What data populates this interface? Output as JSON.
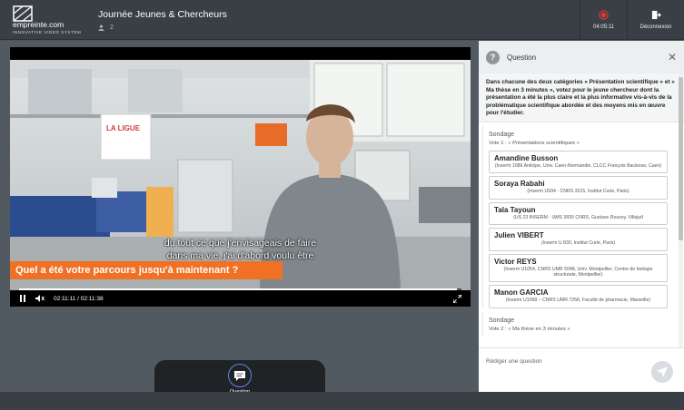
{
  "header": {
    "brand_name": "empreinte.com",
    "brand_tagline": "INNOVATIVE VIDEO SYSTEM",
    "event_title": "Journée Jeunes & Chercheurs",
    "viewer_count": "2",
    "record_time": "04:05:11",
    "logout_label": "Déconnexion"
  },
  "video": {
    "subtitle_line1": "du tout ce que j'envisageais de faire",
    "subtitle_line2": "dans ma vie, j'ai d'abord voulu être",
    "banner_text": "Quel a été votre parcours jusqu'à maintenant ?",
    "time_display": "02:11:11 / 02:11:38",
    "progress": 0.99
  },
  "tray": {
    "question_label": "Question"
  },
  "panel": {
    "title": "Question",
    "intro": "Dans chacune des deux catégories « Présentation scientifique » et « Ma thèse en 3 minutes », votez pour le jeune chercheur dont la présentation a été la plus claire et la plus informative vis-à-vis de la problématique scientifique abordée et des moyens mis en œuvre pour l'étudier.",
    "poll1": {
      "title": "Sondage",
      "vote": "Vote 1 : « Présentations scientifiques »",
      "candidates": [
        {
          "name": "Amandine Busson",
          "aff": "(Inserm 1086 Anticipe, Univ. Caen-Normandie, CLCC François Baclesse, Caen)"
        },
        {
          "name": "Soraya Rabahi",
          "aff": "(Inserm U934 - CNRS 3215, Institut Curie, Paris)"
        },
        {
          "name": "Tala Tayoun",
          "aff": "(US 23 INSERM - UMS 3655 CNRS, Gustave Roussy, Villejuif"
        },
        {
          "name": "Julien VIBERT",
          "aff": "(Inserm U 830, Institut Curie, Paris)"
        },
        {
          "name": "Victor REYS",
          "aff": "(Inserm U1054, CNRS UMR 5048, Univ. Montpellier, Centre de biologie structurale, Montpellier)"
        },
        {
          "name": "Manon GARCIA",
          "aff": "(Inserm U1068 – CNRS UMR 7258, Faculté de pharmacie, Marseille)"
        }
      ]
    },
    "poll2": {
      "title": "Sondage",
      "vote": "Vote 2 : « Ma thèse en 3 minutes »"
    },
    "compose_placeholder": "Rédiger une question"
  }
}
